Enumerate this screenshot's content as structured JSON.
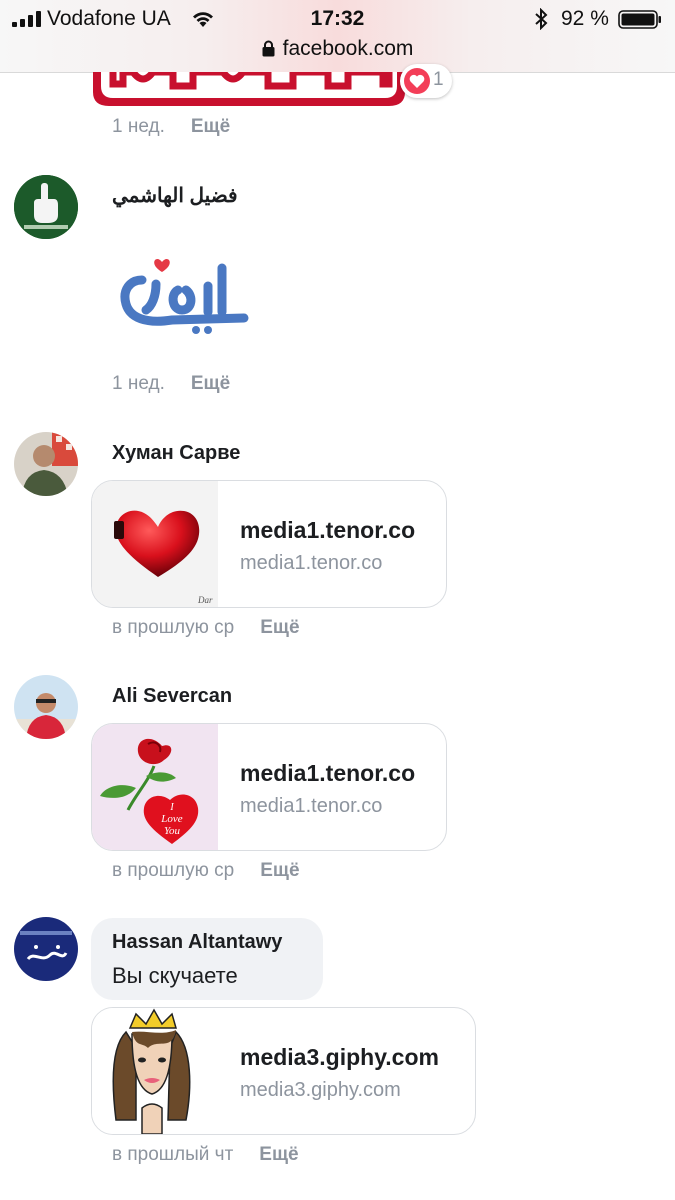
{
  "status_bar": {
    "carrier": "Vodafone UA",
    "time": "17:32",
    "battery_percent": "92 %",
    "url": "facebook.com"
  },
  "top_item": {
    "sticker_icon": "facebook-banner-sticker",
    "reaction_count": "1",
    "time": "1 нед.",
    "more": "Ещё"
  },
  "comments": [
    {
      "name": "فضيل الهاشمي",
      "avatar_icon": "avatar-green-hand",
      "sticker_icon": "jamil-arabic-sticker",
      "time": "1 нед.",
      "more": "Ещё"
    },
    {
      "name": "Хуман Сарве",
      "avatar_icon": "avatar-man-photo",
      "link_title": "media1.tenor.co",
      "link_domain": "media1.tenor.co",
      "thumb_icon": "red-heart-gif",
      "time": "в прошлую ср",
      "more": "Ещё"
    },
    {
      "name": "Ali Severcan",
      "avatar_icon": "avatar-man-red-shirt",
      "link_title": "media1.tenor.co",
      "link_domain": "media1.tenor.co",
      "thumb_icon": "rose-heart-gif",
      "thumb_text": [
        "I",
        "Love",
        "You"
      ],
      "time": "в прошлую ср",
      "more": "Ещё"
    },
    {
      "name": "Hassan Altantawy",
      "avatar_icon": "avatar-blue-arabic",
      "text": "Вы скучаете",
      "link_title": "media3.giphy.com",
      "link_domain": "media3.giphy.com",
      "thumb_icon": "crowned-girl-gif",
      "time": "в прошлый чт",
      "more": "Ещё"
    }
  ],
  "colors": {
    "meta_gray": "#8d949e",
    "bubble_bg": "#f0f2f5",
    "card_border": "#dadde1",
    "heart_red": "#e0245e",
    "jamil_blue": "#4a78c2"
  }
}
